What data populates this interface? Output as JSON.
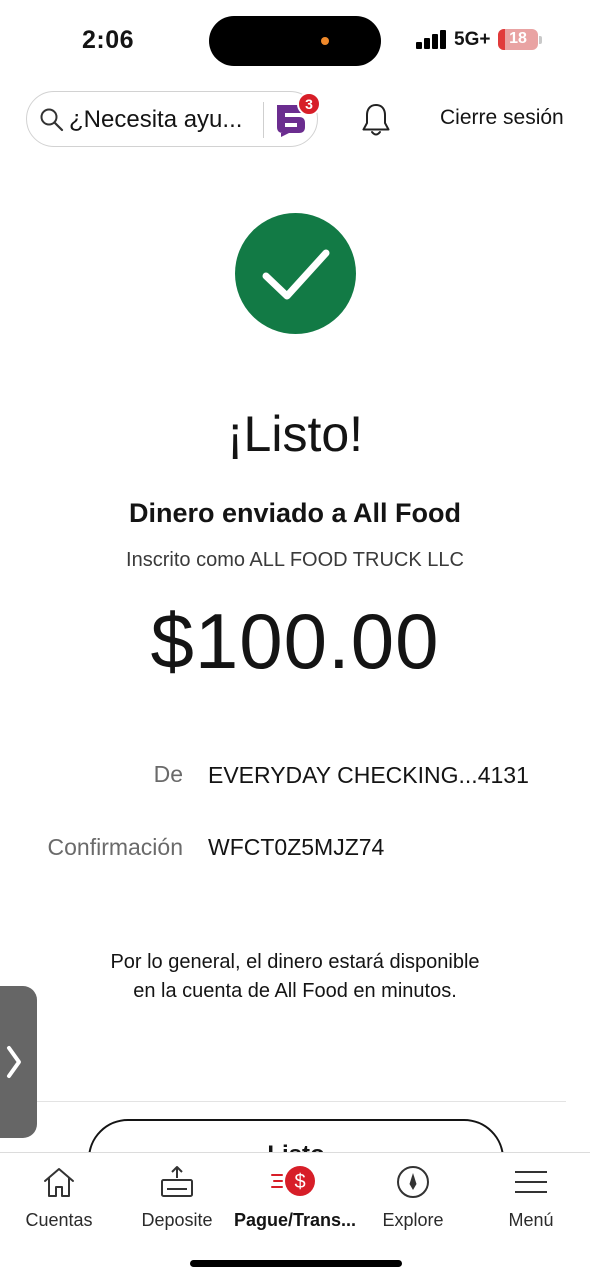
{
  "status_bar": {
    "time": "2:06",
    "network": "5G+",
    "battery_level": "18"
  },
  "header": {
    "search_text": "¿Necesita ayu...",
    "notification_count": "3",
    "logout_label": "Cierre sesión"
  },
  "confirmation": {
    "headline": "¡Listo!",
    "sent_to": "Dinero enviado a All Food",
    "enrolled_as": "Inscrito como ALL FOOD TRUCK LLC",
    "amount": "$100.00",
    "from_label": "De",
    "from_value": "EVERYDAY CHECKING...4131",
    "confirmation_label": "Confirmación",
    "confirmation_value": "WFCT0Z5MJZ74",
    "note": "Por lo general, el dinero estará disponible en la cuenta de All Food en minutos.",
    "done_button_label": "Listo"
  },
  "bottom_nav": {
    "items": [
      {
        "label": "Cuentas",
        "icon": "home-icon"
      },
      {
        "label": "Deposite",
        "icon": "deposit-icon"
      },
      {
        "label": "Pague/Trans...",
        "icon": "pay-transfer-icon",
        "active": true
      },
      {
        "label": "Explore",
        "icon": "compass-icon"
      },
      {
        "label": "Menú",
        "icon": "hamburger-menu-icon"
      }
    ]
  },
  "colors": {
    "success_green": "#127a45",
    "brand_red": "#d71e28",
    "fargo_purple": "#6b2d8f"
  }
}
